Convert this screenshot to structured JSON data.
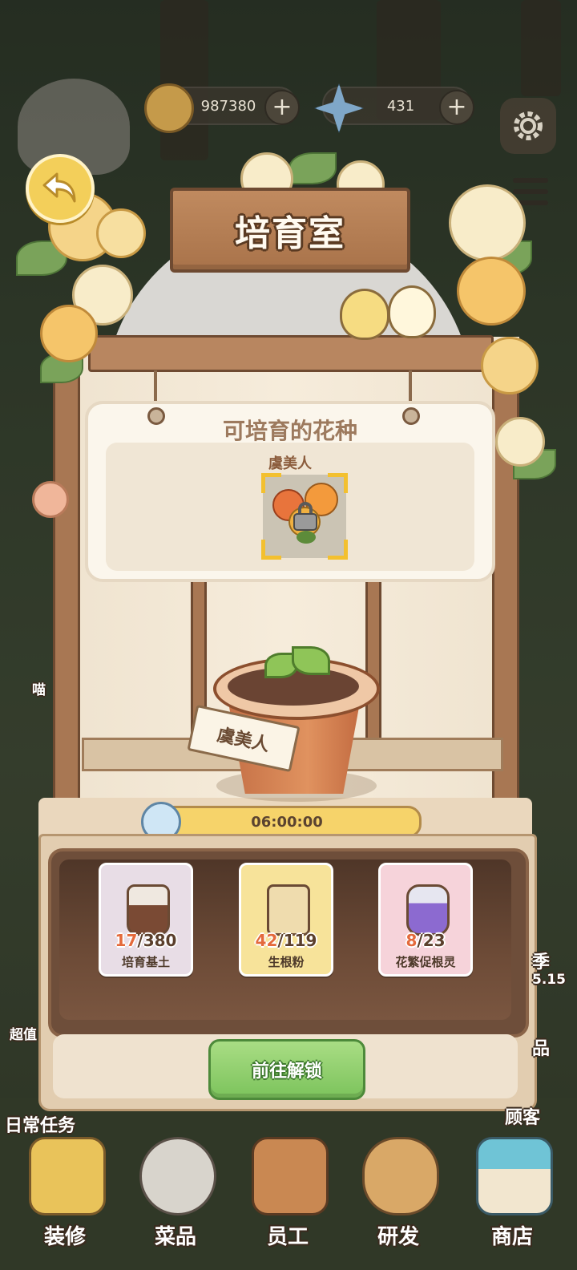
{
  "currency": {
    "coins": "987380",
    "gems": "431"
  },
  "room": {
    "title": "培育室"
  },
  "panel": {
    "title": "可培育的花种",
    "flower_name": "虞美人"
  },
  "pot": {
    "tag_label": "虞美人"
  },
  "timer": {
    "value": "06:00:00"
  },
  "materials": [
    {
      "have": "17",
      "need": "/380",
      "name": "培育基土"
    },
    {
      "have": "42",
      "need": "/119",
      "name": "生根粉"
    },
    {
      "have": "8",
      "need": "/23",
      "name": "花繁促根灵"
    }
  ],
  "unlock_button": "前往解锁",
  "side": {
    "daily_tasks": "日常任务",
    "left_miao": "喵",
    "left_deal": "超值",
    "right_season": "季",
    "right_num": "5.15",
    "right_pin": "品",
    "right_guest": "顾客"
  },
  "nav": [
    {
      "label": "装修",
      "icon": "decorate-icon"
    },
    {
      "label": "菜品",
      "icon": "dishes-icon"
    },
    {
      "label": "员工",
      "icon": "staff-icon"
    },
    {
      "label": "研发",
      "icon": "research-icon"
    },
    {
      "label": "商店",
      "icon": "shop-icon"
    }
  ]
}
